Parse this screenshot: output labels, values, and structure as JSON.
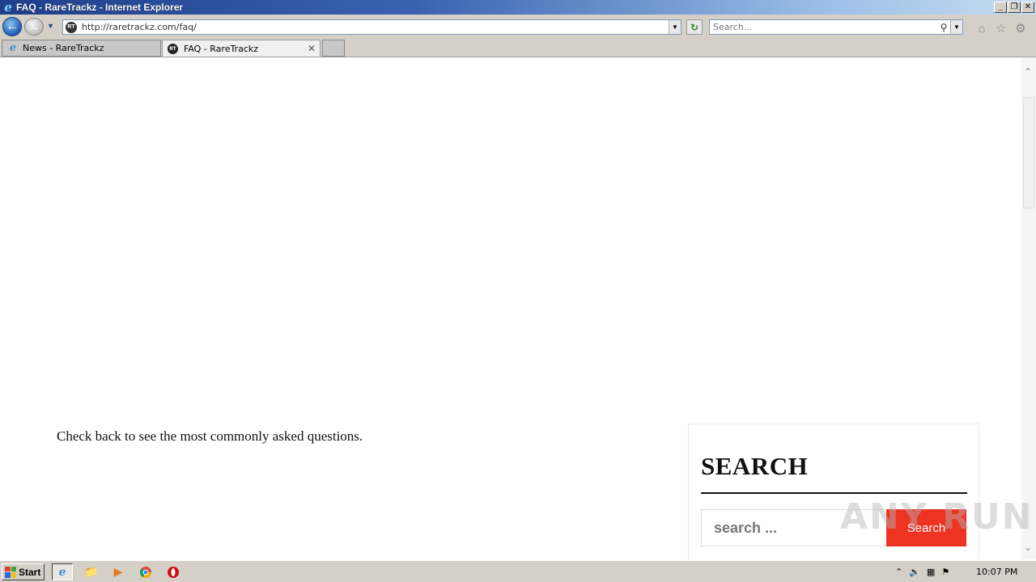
{
  "window": {
    "title": "FAQ - RareTrackz - Internet Explorer",
    "minimize": "_",
    "restore": "❐",
    "close": "✕"
  },
  "navbar": {
    "url": "http://raretrackz.com/faq/",
    "search_placeholder": "Search..."
  },
  "tabs": [
    {
      "label": "News - RareTrackz",
      "active": false
    },
    {
      "label": "FAQ - RareTrackz",
      "active": true
    }
  ],
  "page": {
    "faq_text": "Check back to see the most commonly asked questions.",
    "search_widget": {
      "title": "SEARCH",
      "input_placeholder": "search ...",
      "button_label": "Search"
    }
  },
  "taskbar": {
    "start_label": "Start",
    "clock": "10:07 PM"
  },
  "watermark": "ANY RUN",
  "colors": {
    "accent_red": "#ee3322",
    "taskbar_gray": "#d4d0c8"
  }
}
